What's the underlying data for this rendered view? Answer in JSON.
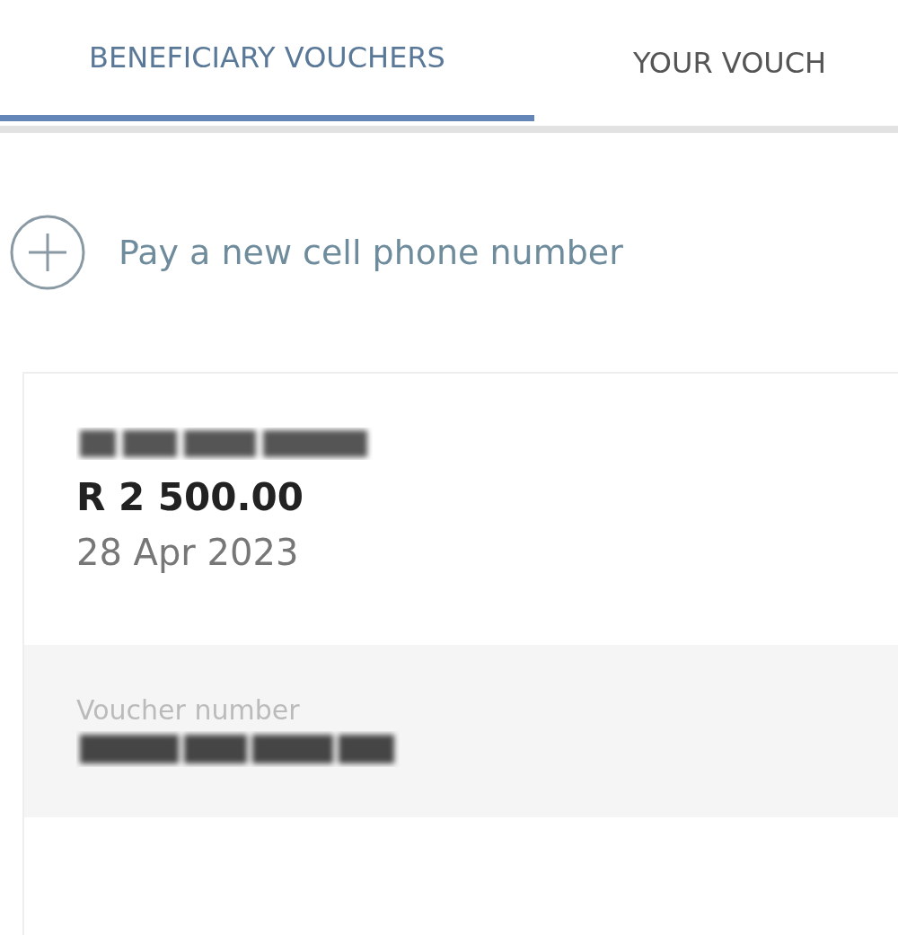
{
  "tabs": [
    {
      "label": "BENEFICIARY VOUCHERS",
      "selected": true
    },
    {
      "label": "YOUR VOUCH",
      "selected": false
    }
  ],
  "add_action": {
    "label": "Pay a new cell phone number"
  },
  "voucher": {
    "amount": "R 2 500.00",
    "date": "28 Apr 2023",
    "number_label": "Voucher number"
  }
}
